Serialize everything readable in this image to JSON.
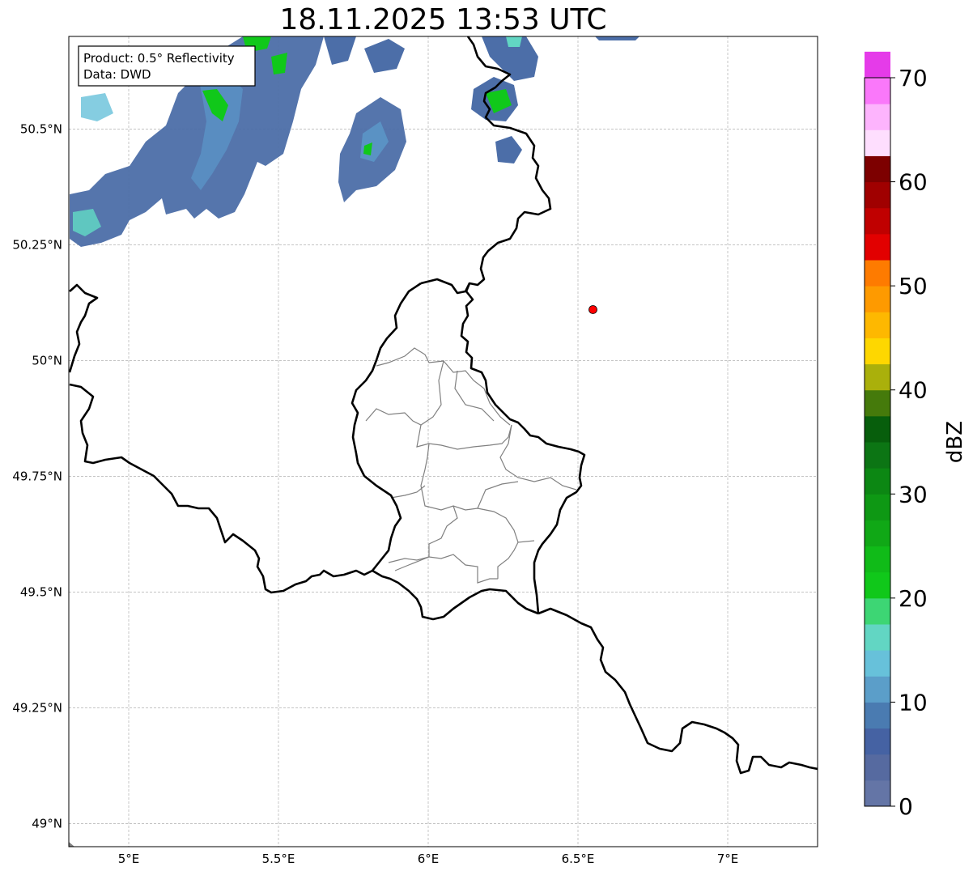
{
  "title": "18.11.2025 13:53 UTC",
  "info_box": {
    "line1": "Product: 0.5° Reflectivity",
    "line2": "Data: DWD"
  },
  "map": {
    "lon_range": [
      4.8,
      7.3
    ],
    "lat_range": [
      48.95,
      50.7
    ],
    "x_ticks": [
      {
        "value": 5.0,
        "label": "5°E"
      },
      {
        "value": 5.5,
        "label": "5.5°E"
      },
      {
        "value": 6.0,
        "label": "6°E"
      },
      {
        "value": 6.5,
        "label": "6.5°E"
      },
      {
        "value": 7.0,
        "label": "7°E"
      }
    ],
    "y_ticks": [
      {
        "value": 49.0,
        "label": "49°N"
      },
      {
        "value": 49.25,
        "label": "49.25°N"
      },
      {
        "value": 49.5,
        "label": "49.5°N"
      },
      {
        "value": 49.75,
        "label": "49.75°N"
      },
      {
        "value": 50.0,
        "label": "50°N"
      },
      {
        "value": 50.25,
        "label": "50.25°N"
      },
      {
        "value": 50.5,
        "label": "50.5°N"
      }
    ],
    "grid": true,
    "marker": {
      "lon": 6.55,
      "lat": 50.11,
      "color": "#ff0000"
    }
  },
  "colorbar": {
    "label": "dBZ",
    "min": 0,
    "max": 70,
    "step": 2.5,
    "ticks": [
      {
        "value": 0,
        "label": "0"
      },
      {
        "value": 10,
        "label": "10"
      },
      {
        "value": 20,
        "label": "20"
      },
      {
        "value": 30,
        "label": "30"
      },
      {
        "value": 40,
        "label": "40"
      },
      {
        "value": 50,
        "label": "50"
      },
      {
        "value": 60,
        "label": "60"
      },
      {
        "value": 70,
        "label": "70"
      }
    ],
    "colors": [
      "#6475a6",
      "#566aa0",
      "#4562a3",
      "#4a7bb1",
      "#5b9ec9",
      "#67c1da",
      "#62d6c3",
      "#3dd674",
      "#10c81a",
      "#10bb18",
      "#10a816",
      "#0e9814",
      "#0c8713",
      "#0c7514",
      "#075e0c",
      "#457a0b",
      "#aab00b",
      "#fed700",
      "#feb800",
      "#fe9a00",
      "#fe7b00",
      "#e20000",
      "#c00000",
      "#a00000",
      "#7d0000",
      "#fedefe",
      "#fdb4fd",
      "#fa78fa",
      "#e53be9"
    ]
  }
}
